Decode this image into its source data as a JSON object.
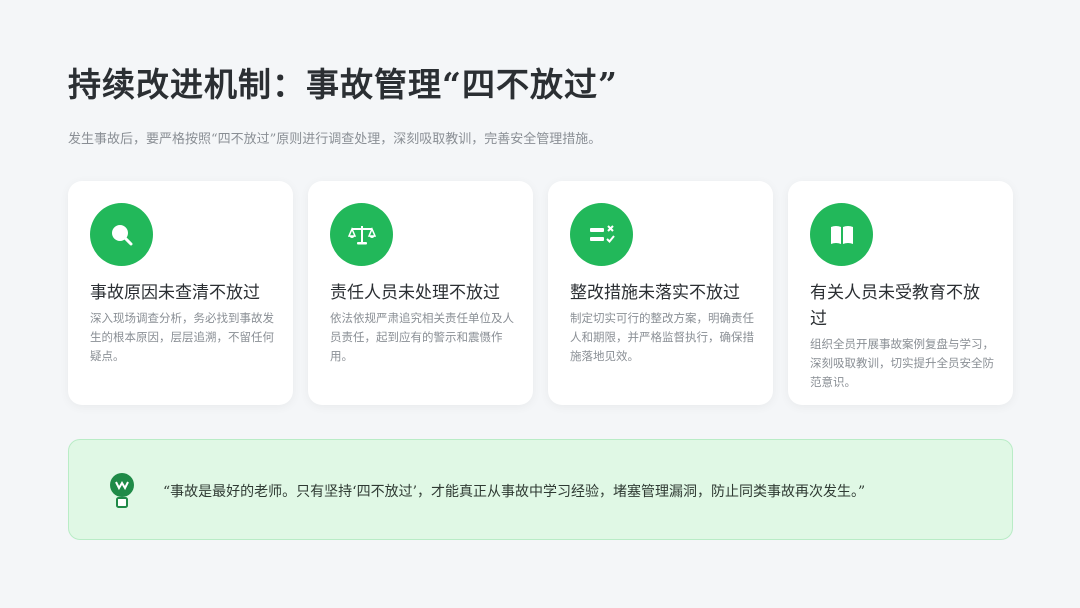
{
  "header": {
    "title": "持续改进机制：事故管理“四不放过”",
    "subtitle": "发生事故后，要严格按照“四不放过”原则进行调查处理，深刻吸取教训，完善安全管理措施。"
  },
  "cards": [
    {
      "icon": "search-icon",
      "title": "事故原因未查清不放过",
      "description": "深入现场调查分析，务必找到事故发生的根本原因，层层追溯，不留任何疑点。"
    },
    {
      "icon": "scale-icon",
      "title": "责任人员未处理不放过",
      "description": "依法依规严肃追究相关责任单位及人员责任，起到应有的警示和震慑作用。"
    },
    {
      "icon": "checklist-icon",
      "title": "整改措施未落实不放过",
      "description": "制定切实可行的整改方案，明确责任人和期限，并严格监督执行，确保措施落地见效。"
    },
    {
      "icon": "book-icon",
      "title": "有关人员未受教育不放过",
      "description": "组织全员开展事故案例复盘与学习，深刻吸取教训，切实提升全员安全防范意识。"
    }
  ],
  "quote": {
    "icon": "lightbulb-icon",
    "text": "“事故是最好的老师。只有坚持‘四不放过’，才能真正从事故中学习经验，堵塞管理漏洞，防止同类事故再次发生。”"
  },
  "colors": {
    "accent": "#22b85a",
    "quote_bg": "#e0f8e5",
    "page_bg": "#f4f6f8"
  }
}
